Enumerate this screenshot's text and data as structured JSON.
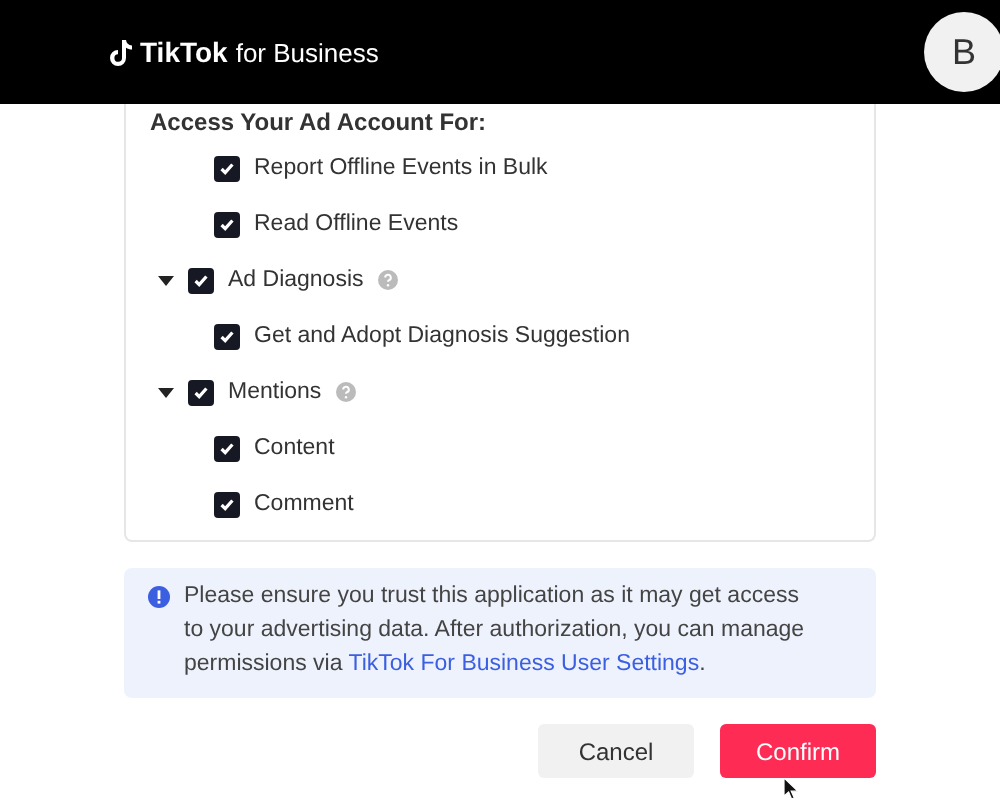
{
  "header": {
    "logo_text": "TikTok",
    "logo_suffix": "for Business",
    "avatar": "B"
  },
  "section_title": "Access Your Ad Account For:",
  "permissions": [
    {
      "children": [
        {
          "label": "Report Offline Events in Bulk",
          "checked": true
        },
        {
          "label": "Read Offline Events",
          "checked": true
        }
      ]
    },
    {
      "label": "Ad Diagnosis",
      "checked": true,
      "expanded": true,
      "children": [
        {
          "label": "Get and Adopt Diagnosis Suggestion",
          "checked": true
        }
      ]
    },
    {
      "label": "Mentions",
      "checked": true,
      "expanded": true,
      "children": [
        {
          "label": "Content",
          "checked": true
        },
        {
          "label": "Comment",
          "checked": true
        }
      ]
    }
  ],
  "notice": {
    "text": "Please ensure you trust this application as it may get access to your advertising data. After authorization, you can manage permissions via ",
    "link": "TikTok For Business User Settings",
    "end": "."
  },
  "buttons": [
    {
      "label": "Cancel",
      "kind": "secondary"
    },
    {
      "label": "Confirm",
      "kind": "primary"
    }
  ]
}
